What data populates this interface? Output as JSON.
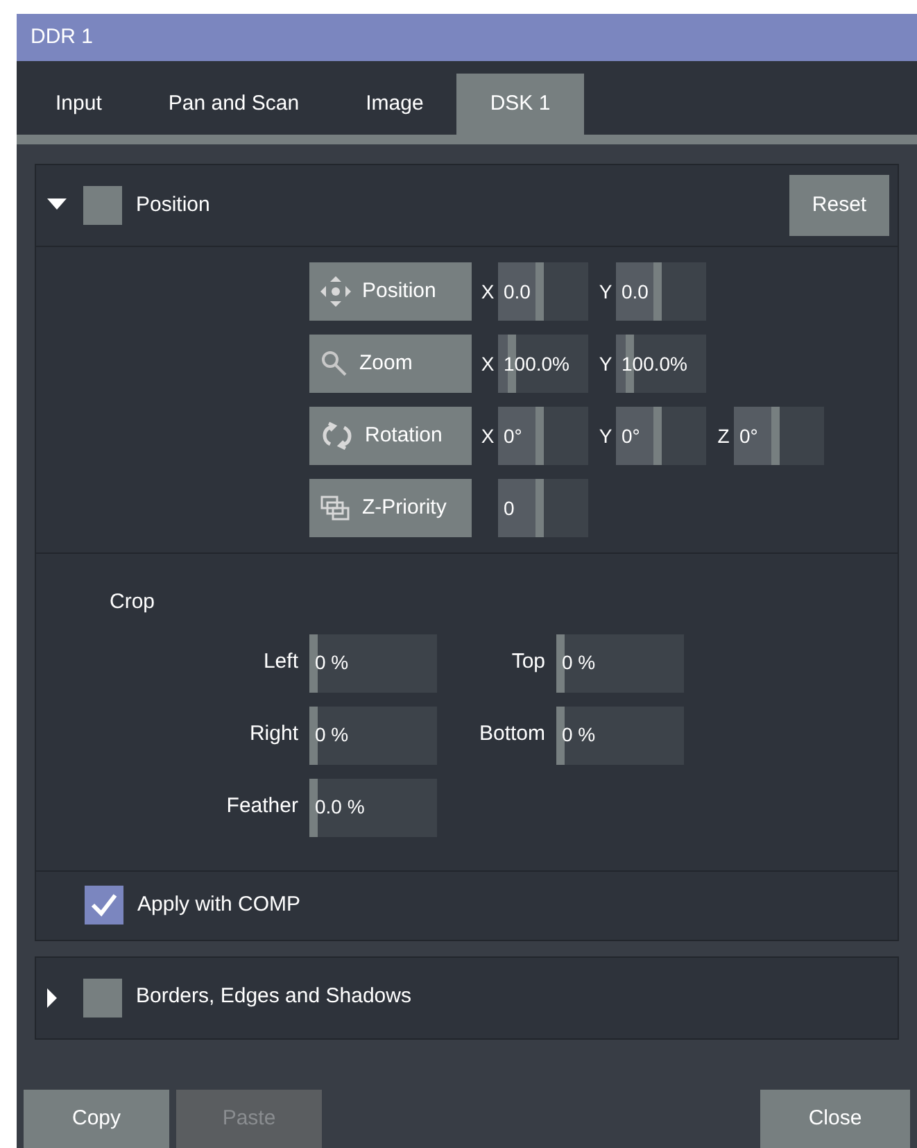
{
  "window": {
    "title": "DDR 1"
  },
  "tabs": [
    {
      "label": "Input",
      "selected": false
    },
    {
      "label": "Pan and Scan",
      "selected": false
    },
    {
      "label": "Image",
      "selected": false
    },
    {
      "label": "DSK 1",
      "selected": true
    }
  ],
  "position_section": {
    "title": "Position",
    "expanded": true,
    "enabled": false,
    "reset_button": "Reset",
    "rows": [
      {
        "kind": "move",
        "label": "Position",
        "fields": [
          {
            "axis": "X",
            "value": "0.0",
            "level": 0.5
          },
          {
            "axis": "Y",
            "value": "0.0",
            "level": 0.5
          }
        ]
      },
      {
        "kind": "zoom",
        "label": "Zoom",
        "fields": [
          {
            "axis": "X",
            "value": "100.0%",
            "level": 0.2
          },
          {
            "axis": "Y",
            "value": "100.0%",
            "level": 0.2
          }
        ]
      },
      {
        "kind": "rotate",
        "label": "Rotation",
        "fields": [
          {
            "axis": "X",
            "value": "0°",
            "level": 0.5
          },
          {
            "axis": "Y",
            "value": "0°",
            "level": 0.5
          },
          {
            "axis": "Z",
            "value": "0°",
            "level": 0.5
          }
        ]
      },
      {
        "kind": "layers",
        "label": "Z-Priority",
        "fields": [
          {
            "value": "0",
            "level": 0.5
          }
        ]
      }
    ],
    "crop": {
      "title": "Crop",
      "fields": [
        {
          "label": "Left",
          "value": "0 %",
          "level": 0
        },
        {
          "label": "Top",
          "value": "0 %",
          "level": 0
        },
        {
          "label": "Right",
          "value": "0 %",
          "level": 0
        },
        {
          "label": "Bottom",
          "value": "0 %",
          "level": 0
        },
        {
          "label": "Feather",
          "value": "0.0 %",
          "level": 0
        }
      ]
    },
    "apply_with_comp": {
      "label": "Apply with COMP",
      "checked": true
    }
  },
  "borders_section": {
    "title": "Borders, Edges and Shadows",
    "expanded": false,
    "enabled": false
  },
  "buttons": [
    {
      "label": "Copy",
      "disabled": false
    },
    {
      "label": "Paste",
      "disabled": true
    },
    {
      "label": "Close",
      "disabled": false
    }
  ]
}
